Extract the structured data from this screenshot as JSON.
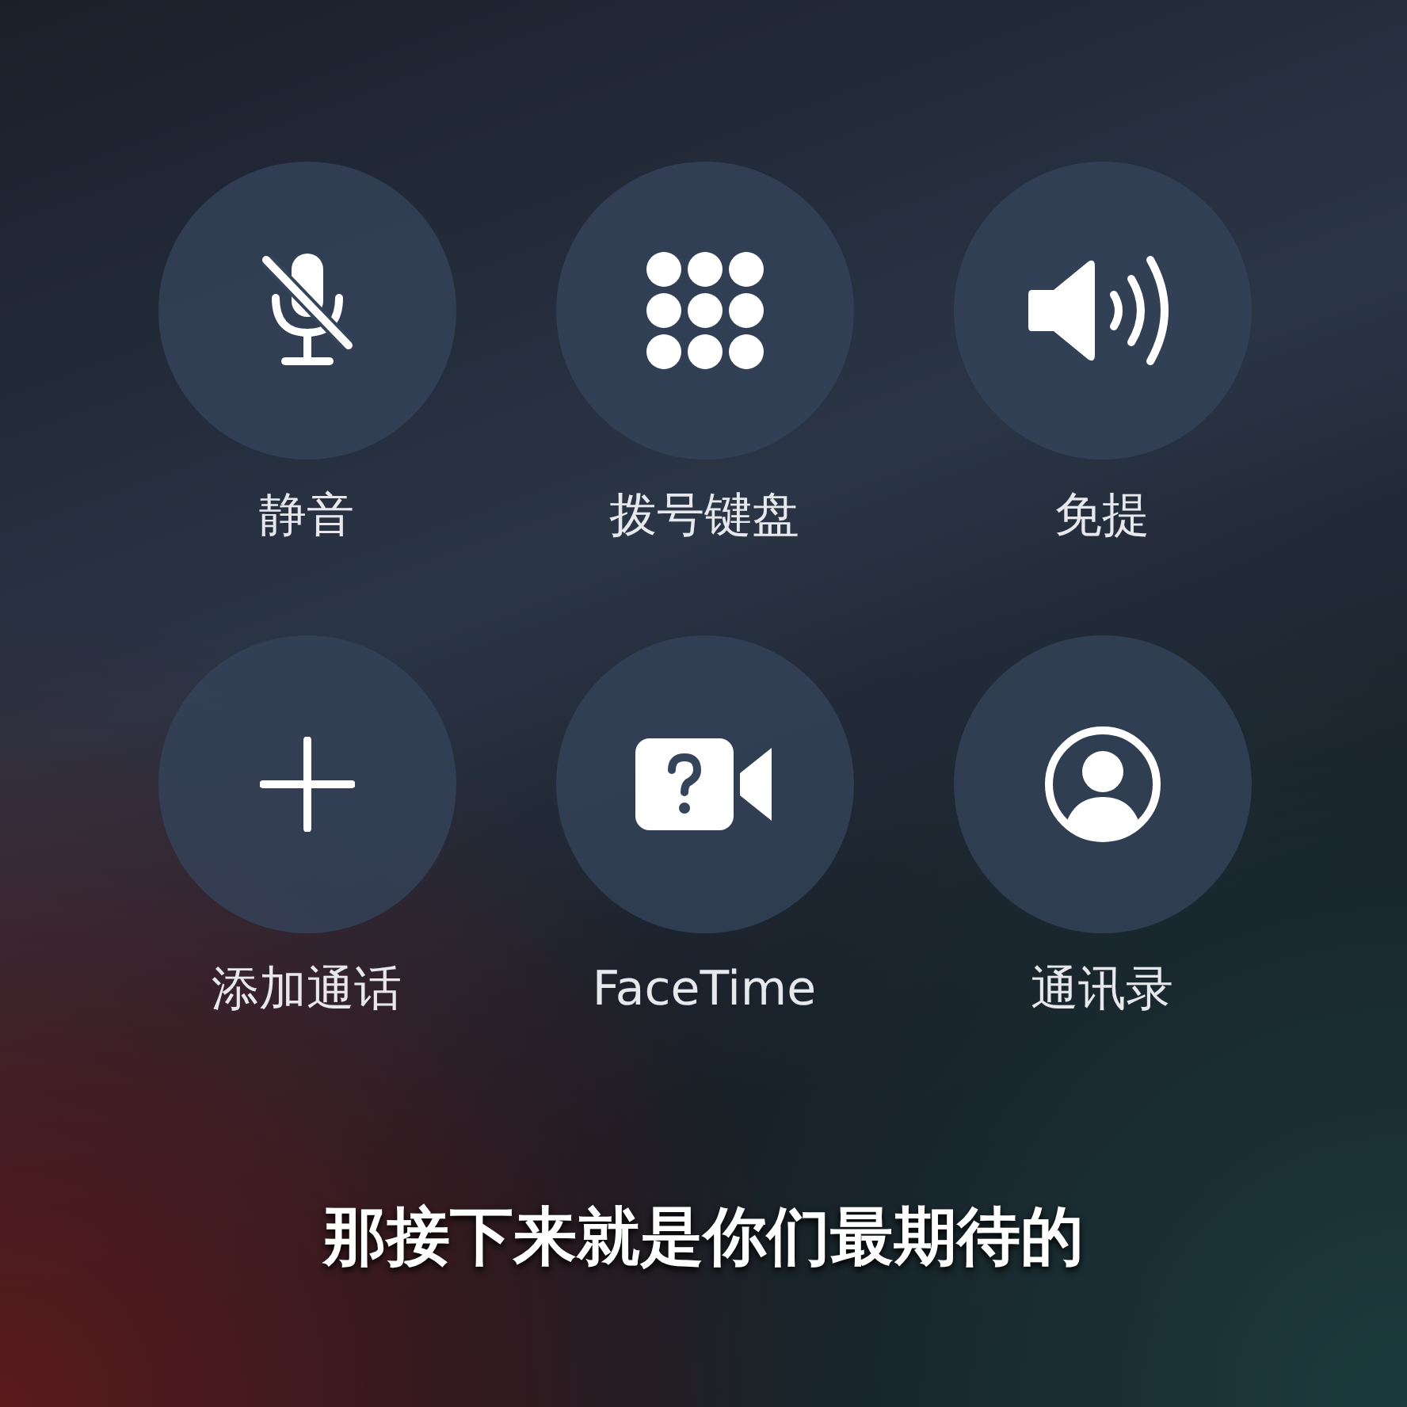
{
  "call_buttons": [
    {
      "kind": "mute",
      "label": "静音"
    },
    {
      "kind": "keypad",
      "label": "拨号键盘"
    },
    {
      "kind": "speaker",
      "label": "免提"
    },
    {
      "kind": "add",
      "label": "添加通话"
    },
    {
      "kind": "facetime",
      "label": "FaceTime"
    },
    {
      "kind": "contacts",
      "label": "通讯录"
    }
  ],
  "subtitle": "那接下来就是你们最期待的"
}
